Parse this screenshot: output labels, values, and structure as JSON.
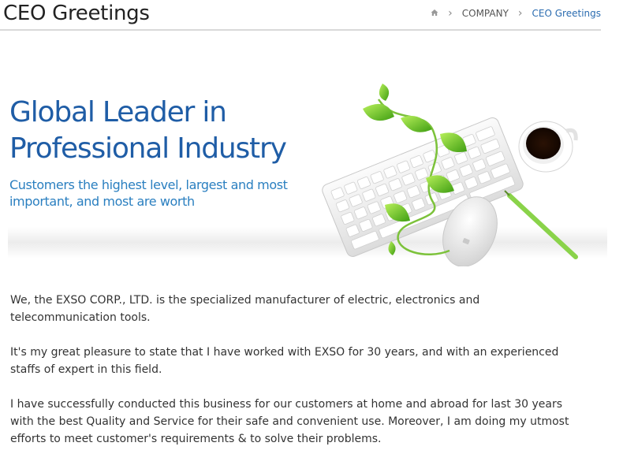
{
  "header": {
    "title": "CEO Greetings",
    "breadcrumb": {
      "home_icon": "home-icon",
      "items": [
        "COMPANY",
        "CEO Greetings"
      ]
    }
  },
  "banner": {
    "headline_line1": "Global Leader in",
    "headline_line2": "Professional Industry",
    "subline_line1": "Customers the highest level, largest and most",
    "subline_line2": "important, and most are worth",
    "illustration": "keyboard-mouse-coffee-plant-illustration"
  },
  "content": {
    "paragraphs": [
      "We, the EXSO CORP., LTD. is the specialized manufacturer of electric, electronics and telecommunication tools.",
      "It's my great pleasure to state that I have worked with EXSO for 30 years, and with an experienced staffs of expert in this field.",
      "I have successfully conducted this business for our customers at home and abroad for last 30 years with the best Quality and Service for their safe and convenient use. Moreover, I am doing my utmost efforts to meet customer's requirements & to solve their problems."
    ]
  },
  "colors": {
    "headline": "#1f5da6",
    "subline": "#2a7fc0",
    "breadcrumb_active": "#2b6cb0",
    "rule": "#d9d9d9"
  }
}
